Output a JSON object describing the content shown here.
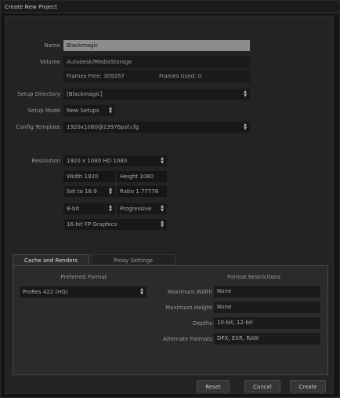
{
  "window": {
    "title": "Create New Project"
  },
  "form": {
    "name": {
      "label": "Name",
      "value": "Blackmagic"
    },
    "volume": {
      "label": "Volume",
      "value": "Autodesk/MediaStorage",
      "frames_free": "Frames Free: 309267",
      "frames_used": "Frames Used: 0"
    },
    "setup_directory": {
      "label": "Setup Directory",
      "value": "[Blackmagic]"
    },
    "setup_mode": {
      "label": "Setup Mode",
      "value": "New Setups"
    },
    "config_template": {
      "label": "Config Template",
      "value": "1920x1080@23976psf.cfg"
    }
  },
  "resolution": {
    "label": "Resolution",
    "preset": "1920 x 1080 HD 1080",
    "width": "Width 1920",
    "height": "Height 1080",
    "aspect_preset": "Set to 16:9",
    "ratio": "Ratio 1.77778",
    "bit_depth": "8-bit",
    "scan": "Progressive",
    "precision": "16-bit FP Graphics"
  },
  "tabs": [
    {
      "label": "Cache and Renders"
    },
    {
      "label": "Proxy Settings"
    }
  ],
  "cache": {
    "preferred_format_header": "Preferred Format",
    "preferred_format_value": "ProRes 422 (HQ)",
    "restrictions_header": "Format Restrictions",
    "max_width": {
      "label": "Maximum Width",
      "value": "None"
    },
    "max_height": {
      "label": "Maximum Height",
      "value": "None"
    },
    "depths": {
      "label": "Depths",
      "value": "10-bit, 12-bit"
    },
    "alternate_formats": {
      "label": "Alternate Formats",
      "value": "DPX, EXR, RAW"
    }
  },
  "buttons": {
    "reset": "Reset",
    "cancel": "Cancel",
    "create": "Create"
  },
  "icons": {
    "spinner": "up-down-arrows-icon"
  }
}
